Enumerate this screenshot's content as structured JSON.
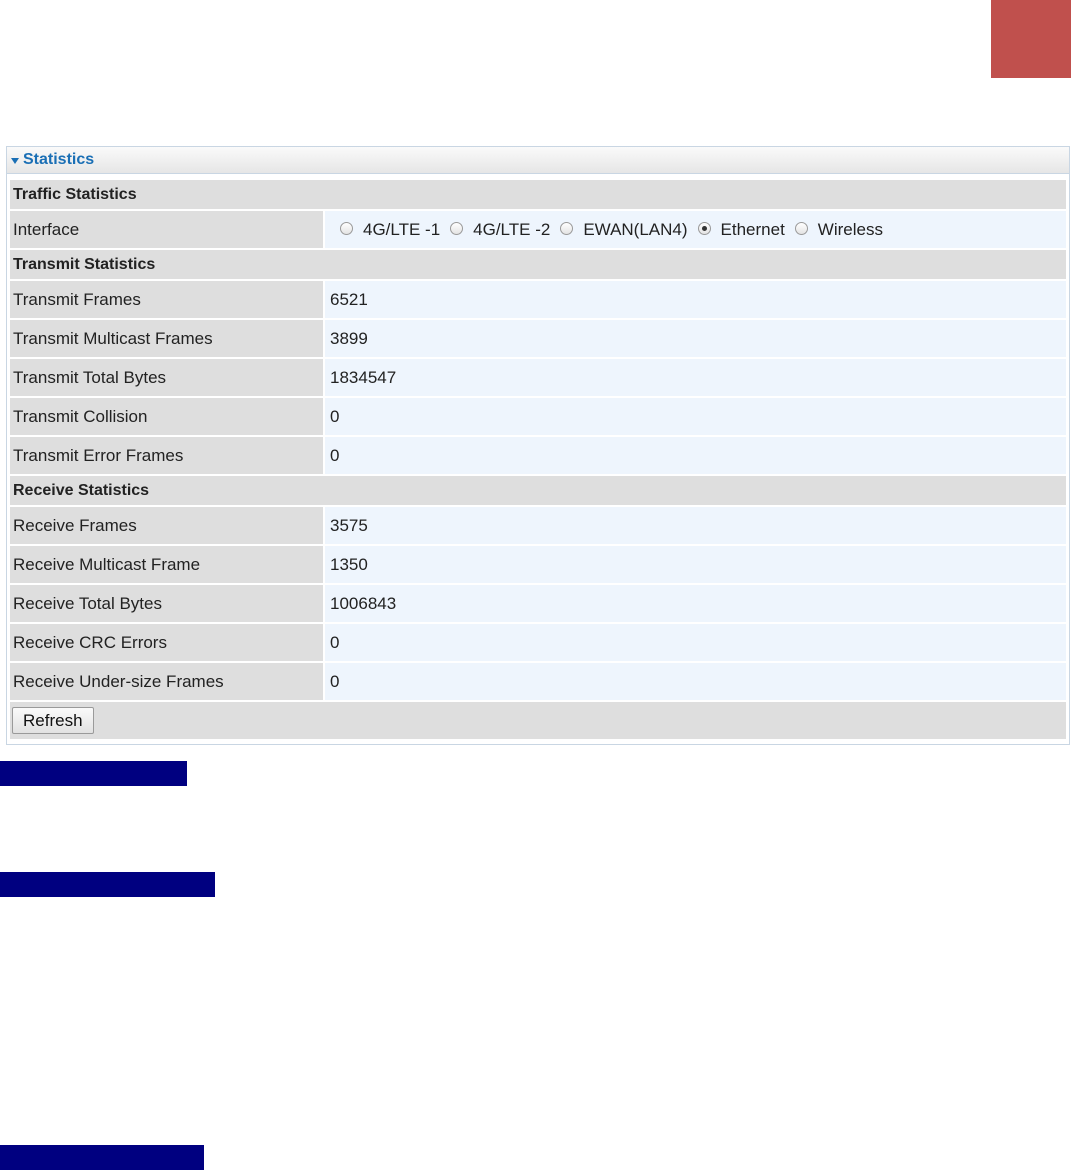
{
  "panel": {
    "title": "Statistics",
    "sections": {
      "traffic": "Traffic Statistics",
      "transmit": "Transmit Statistics",
      "receive": "Receive Statistics"
    },
    "interface": {
      "label": "Interface",
      "options": [
        "4G/LTE -1",
        "4G/LTE -2",
        "EWAN(LAN4)",
        "Ethernet",
        "Wireless"
      ],
      "selected": "Ethernet"
    },
    "transmit_rows": [
      {
        "label": "Transmit Frames",
        "value": "6521"
      },
      {
        "label": "Transmit Multicast Frames",
        "value": "3899"
      },
      {
        "label": "Transmit Total Bytes",
        "value": "1834547"
      },
      {
        "label": "Transmit Collision",
        "value": "0"
      },
      {
        "label": "Transmit Error Frames",
        "value": "0"
      }
    ],
    "receive_rows": [
      {
        "label": "Receive Frames",
        "value": "3575"
      },
      {
        "label": "Receive Multicast Frame",
        "value": "1350"
      },
      {
        "label": "Receive Total Bytes",
        "value": "1006843"
      },
      {
        "label": "Receive CRC Errors",
        "value": "0"
      },
      {
        "label": "Receive Under-size Frames",
        "value": "0"
      }
    ],
    "refresh_label": "Refresh"
  },
  "colors": {
    "corner_block": "#c0504d",
    "highlight_bar": "#000080",
    "header_text": "#1a6fb5"
  }
}
